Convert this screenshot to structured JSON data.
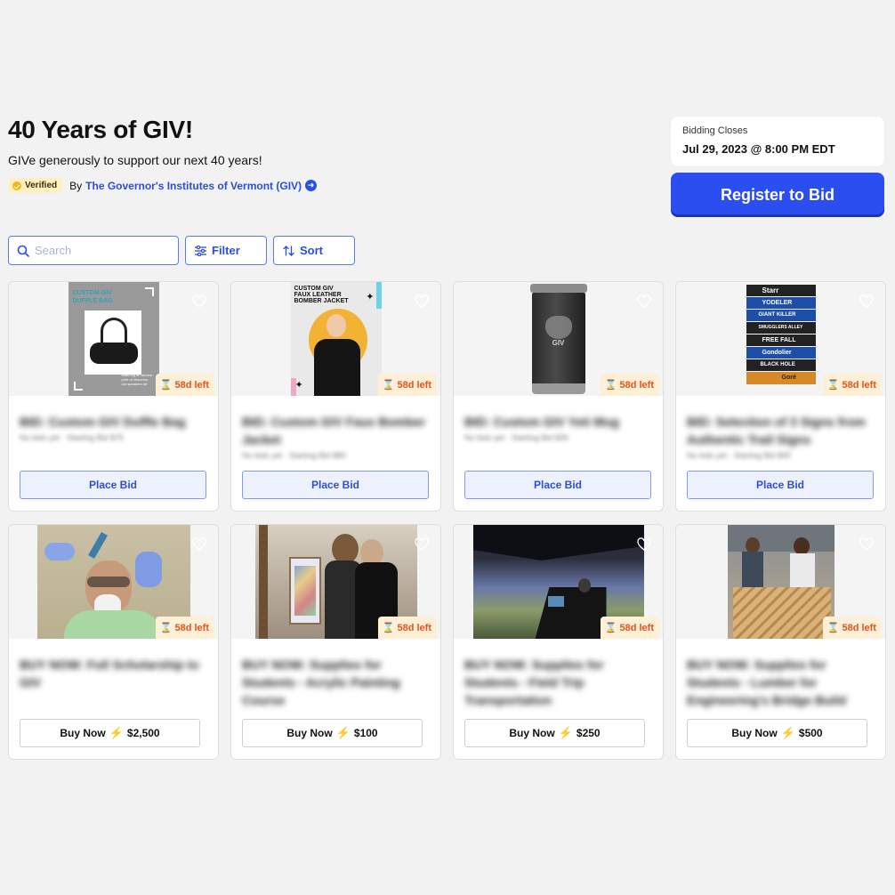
{
  "header": {
    "title": "40 Years of GIV!",
    "subtitle": "GIVe generously to support our next 40 years!",
    "verified": "Verified",
    "by": "By",
    "org": "The Governor's Institutes of Vermont (GIV)"
  },
  "closing": {
    "label": "Bidding Closes",
    "date": "Jul 29, 2023 @ 8:00 PM EDT"
  },
  "register_label": "Register to Bid",
  "toolbar": {
    "search_placeholder": "Search",
    "filter_label": "Filter",
    "sort_label": "Sort"
  },
  "items": [
    {
      "time_left": "58d left",
      "title": "BID: Custom GIV Duffle Bag",
      "meta": "No bids yet · Starting Bid $75",
      "action": "Place Bid",
      "image_text": [
        "CUSTOM GIV",
        "DUFFLE BAG"
      ],
      "image_caption": "featuring an all-new print of Vesuvius, our speakers art"
    },
    {
      "time_left": "58d left",
      "title": "BID: Custom GIV Faux Bomber Jacket",
      "meta": "No bids yet · Starting Bid $80",
      "action": "Place Bid",
      "image_text": [
        "CUSTOM GIV",
        "FAUX LEATHER",
        "BOMBER JACKET"
      ]
    },
    {
      "time_left": "58d left",
      "title": "BID: Custom GIV Yeti Mug",
      "meta": "No bids yet · Starting Bid $35",
      "action": "Place Bid",
      "image_text": [
        "GIV"
      ]
    },
    {
      "time_left": "58d left",
      "title": "BID: Selection of 3 Signs from Authentic Trail Signs",
      "meta": "No bids yet · Starting Bid $90",
      "action": "Place Bid",
      "image_text": [
        "Starr",
        "YODELER",
        "GIANT KILLER",
        "SMUGGLERS ALLEY",
        "FREE FALL",
        "Gondolier",
        "BLACK HOLE",
        "Goré"
      ]
    },
    {
      "time_left": "58d left",
      "title": "BUY NOW: Full Scholarship to GIV",
      "action": "Buy Now",
      "price": "$2,500"
    },
    {
      "time_left": "58d left",
      "title": "BUY NOW: Supplies for Students - Acrylic Painting Course",
      "action": "Buy Now",
      "price": "$100"
    },
    {
      "time_left": "58d left",
      "title": "BUY NOW: Supplies for Students - Field Trip Transportation",
      "action": "Buy Now",
      "price": "$250"
    },
    {
      "time_left": "58d left",
      "title": "BUY NOW: Supplies for Students - Lumber for Engineering's Bridge Build",
      "action": "Buy Now",
      "price": "$500"
    }
  ],
  "colors": {
    "accent": "#2b4ef0",
    "timer": "#e6531c",
    "timer_bg": "#fdf0d6",
    "bolt": "#f2b705"
  }
}
